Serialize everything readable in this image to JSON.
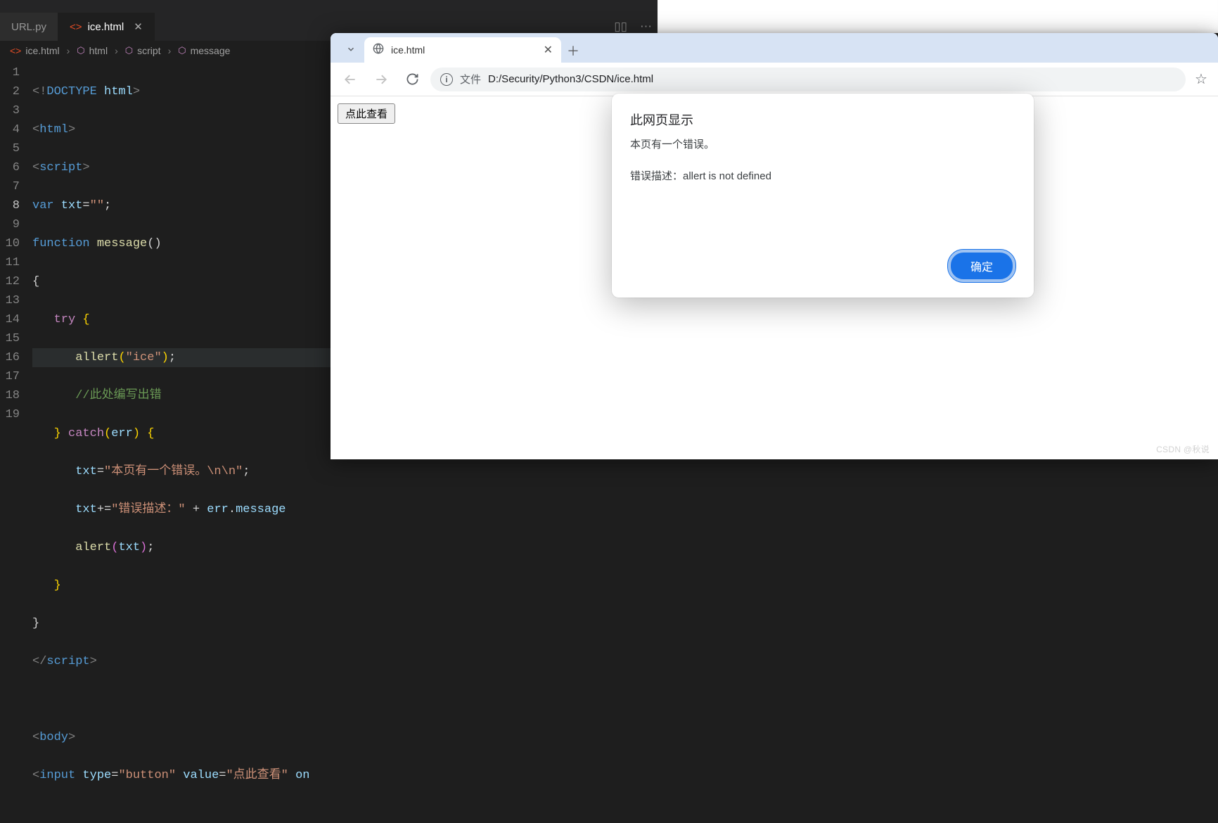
{
  "vscode": {
    "tabs": [
      {
        "label": "URL.py",
        "active": false
      },
      {
        "label": "ice.html",
        "active": true
      }
    ],
    "breadcrumb": [
      "ice.html",
      "html",
      "script",
      "message"
    ],
    "gutter": [
      "1",
      "2",
      "3",
      "4",
      "5",
      "6",
      "7",
      "8",
      "9",
      "10",
      "11",
      "12",
      "13",
      "14",
      "15",
      "16",
      "17",
      "18",
      "19"
    ],
    "current_line_index": 7,
    "code": {
      "l1": {
        "a": "<!",
        "b": "DOCTYPE",
        "c": " html",
        "d": ">"
      },
      "l2": {
        "a": "<",
        "b": "html",
        "c": ">"
      },
      "l3": {
        "a": "<",
        "b": "script",
        "c": ">"
      },
      "l4": {
        "a": "var",
        "b": " txt",
        "c": "=",
        "d": "\"\"",
        "e": ";"
      },
      "l5": {
        "a": "function",
        "b": " message",
        "c": "()"
      },
      "l6": {
        "a": "{"
      },
      "l7": {
        "a": "try",
        "b": " {"
      },
      "l8": {
        "a": "allert",
        "b": "(",
        "c": "\"ice\"",
        "d": ")",
        "e": ";"
      },
      "l9": {
        "a": "//此处编写出错"
      },
      "l10": {
        "a": "}",
        "b": " catch",
        "c": "(",
        "d": "err",
        "e": ")",
        "f": " {"
      },
      "l11": {
        "a": "txt",
        "b": "=",
        "c": "\"本页有一个错误。\\n\\n\"",
        "d": ";"
      },
      "l12": {
        "a": "txt",
        "b": "+=",
        "c": "\"错误描述：\"",
        "d": " + ",
        "e": "err",
        "f": ".",
        "g": "message"
      },
      "l13": {
        "a": "alert",
        "b": "(",
        "c": "txt",
        "d": ")",
        "e": ";"
      },
      "l14": {
        "a": "}"
      },
      "l15": {
        "a": "}"
      },
      "l16": {
        "a": "</",
        "b": "script",
        "c": ">"
      },
      "l18": {
        "a": "<",
        "b": "body",
        "c": ">"
      },
      "l19": {
        "a": "<",
        "b": "input",
        "c": " type",
        "d": "=",
        "e": "\"button\"",
        "f": " value",
        "g": "=",
        "h": "\"点此查看\"",
        "i": " on"
      }
    }
  },
  "browser": {
    "tab_label": "ice.html",
    "addr_hint": "文件",
    "url": "D:/Security/Python3/CSDN/ice.html",
    "page_button_label": "点此查看",
    "modal": {
      "title": "此网页显示",
      "message": "本页有一个错误。\n\n错误描述：allert is not defined",
      "ok_label": "确定"
    }
  },
  "watermark": "CSDN @秋说"
}
